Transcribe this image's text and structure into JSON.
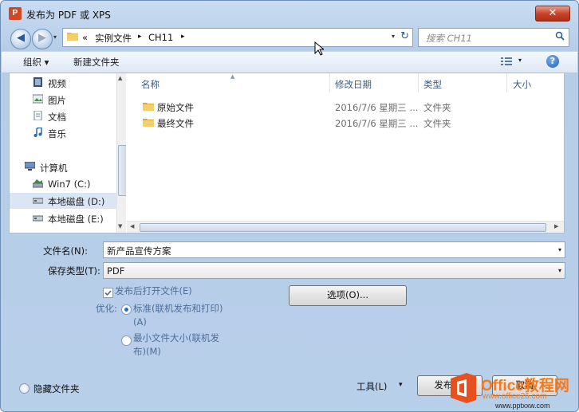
{
  "window": {
    "app_icon": "P",
    "title": "发布为 PDF 或 XPS",
    "close_glyph": "✕"
  },
  "nav": {
    "back_glyph": "◀",
    "forward_glyph": "▶",
    "dropdown_glyph": "▾",
    "refresh_glyph": "↻"
  },
  "address": {
    "chevron": "«",
    "segments": [
      "实例文件",
      "CH11"
    ],
    "sep": "▸"
  },
  "search": {
    "placeholder": "搜索 CH11"
  },
  "toolbar": {
    "organize": "组织 ▾",
    "new_folder": "新建文件夹",
    "help": "?"
  },
  "sidebar": {
    "items": [
      {
        "label": "视频",
        "icon": "video-icon"
      },
      {
        "label": "图片",
        "icon": "pictures-icon"
      },
      {
        "label": "文档",
        "icon": "documents-icon"
      },
      {
        "label": "音乐",
        "icon": "music-icon"
      },
      {
        "label": "计算机",
        "icon": "computer-icon"
      },
      {
        "label": "Win7 (C:)",
        "icon": "drive-c-icon"
      },
      {
        "label": "本地磁盘 (D:)",
        "icon": "drive-icon"
      },
      {
        "label": "本地磁盘 (E:)",
        "icon": "drive-icon"
      }
    ]
  },
  "columns": {
    "name": "名称",
    "date": "修改日期",
    "type": "类型",
    "size": "大小"
  },
  "files": [
    {
      "name": "原始文件",
      "date": "2016/7/6 星期三 ...",
      "type": "文件夹"
    },
    {
      "name": "最终文件",
      "date": "2016/7/6 星期三 ...",
      "type": "文件夹"
    }
  ],
  "form": {
    "filename_label": "文件名(N):",
    "filename_value": "新产品宣传方案",
    "filetype_label": "保存类型(T):",
    "filetype_value": "PDF",
    "open_after": "发布后打开文件(E)",
    "optimize_label": "优化:",
    "opt_standard": "标准(联机发布和打印)\n(A)",
    "opt_minimum": "最小文件大小(联机发\n布)(M)",
    "options_button": "选项(O)..."
  },
  "footer": {
    "hide_folders": "隐藏文件夹",
    "tools": "工具(L)",
    "tools_drop": "▾",
    "publish": "发布(S)",
    "cancel": "取消"
  },
  "watermark": {
    "brand": "Office教程网",
    "url": "www.office26.com",
    "url2": "www.pptxxw.com"
  }
}
